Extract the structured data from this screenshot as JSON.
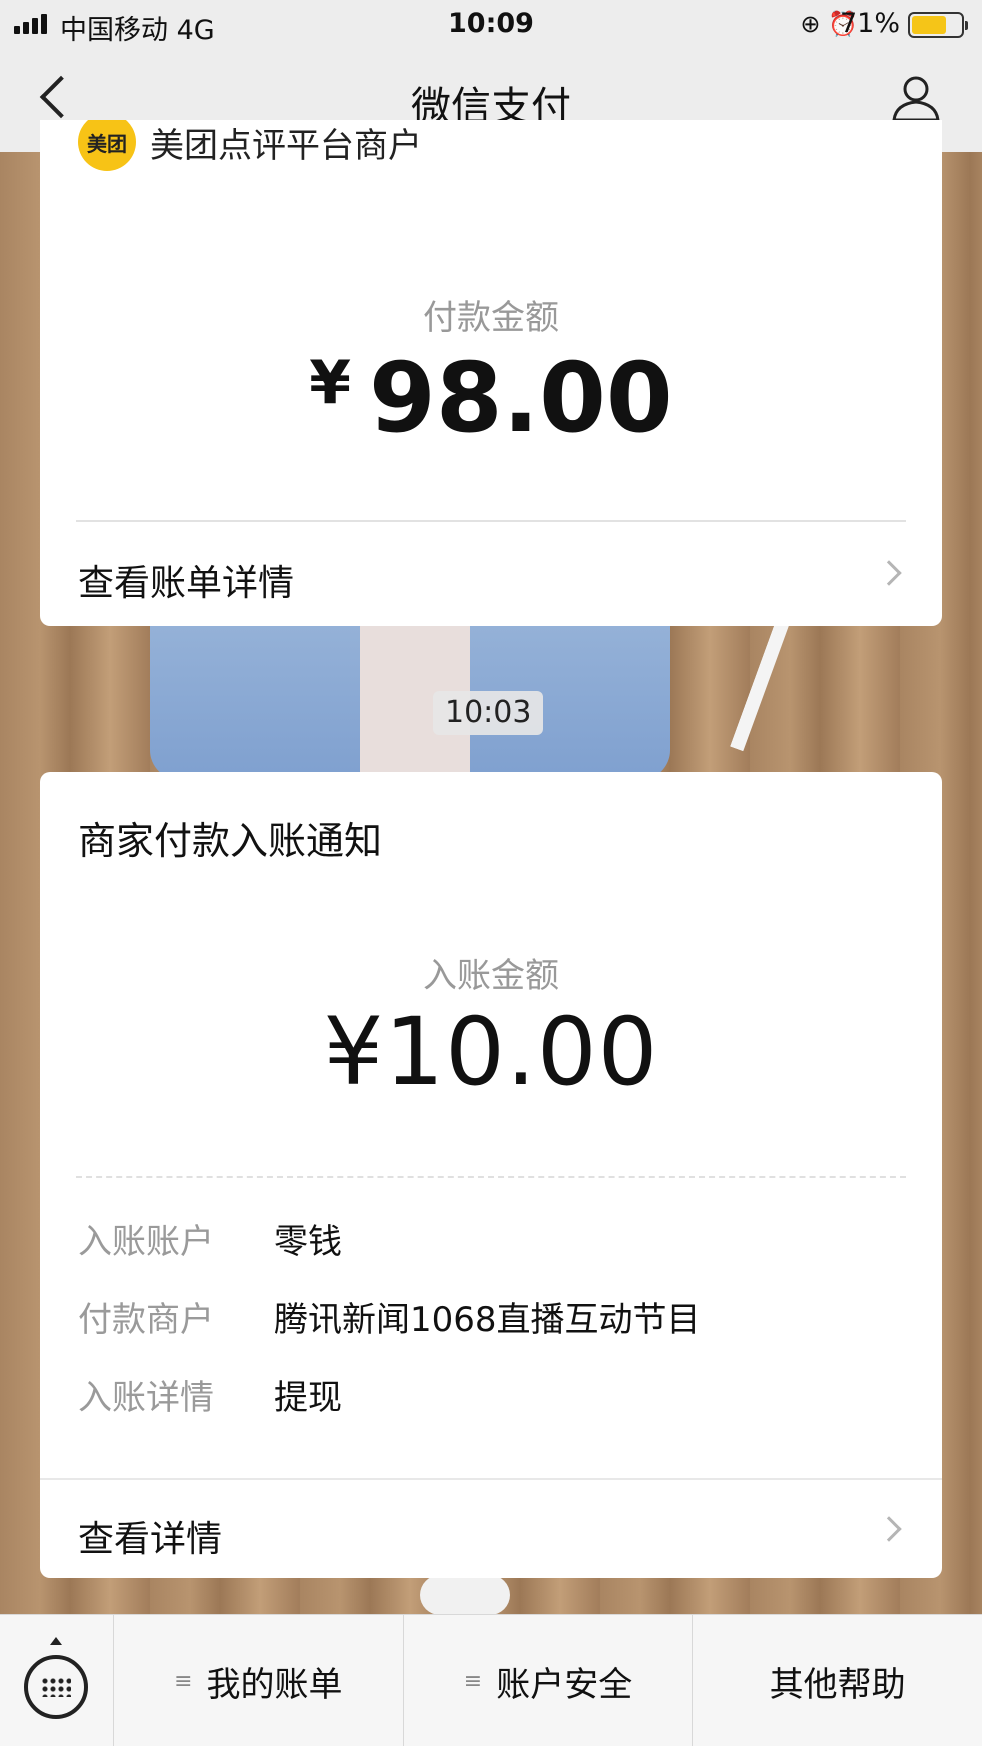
{
  "status_bar": {
    "carrier": "中国移动  4G",
    "time": "10:09",
    "icons": [
      "rotation-lock-icon",
      "alarm-icon"
    ],
    "battery_pct": "71%",
    "battery_level": 0.71
  },
  "nav": {
    "title": "微信支付",
    "back_icon": "back-chevron-icon",
    "user_icon": "user-icon"
  },
  "payment_card": {
    "merchant_logo_text": "美团",
    "merchant_name": "美团点评平台商户",
    "amount_label": "付款金额",
    "currency": "¥",
    "amount": "98.00",
    "detail_link": "查看账单详情"
  },
  "timestamp": "10:03",
  "notice_card": {
    "title": "商家付款入账通知",
    "amount_label": "入账金额",
    "amount": "¥10.00",
    "rows": [
      {
        "key": "入账账户",
        "value": "零钱"
      },
      {
        "key": "付款商户",
        "value": "腾讯新闻1068直播互动节目"
      },
      {
        "key": "入账详情",
        "value": "提现"
      }
    ],
    "detail_link": "查看详情"
  },
  "bottom_bar": {
    "keyboard_icon": "keyboard-icon",
    "menu_glyph": "≡",
    "items": [
      "我的账单",
      "账户安全",
      "其他帮助"
    ]
  },
  "colors": {
    "brand_yellow": "#f7c316",
    "bar_bg": "#ededed",
    "label_gray": "#9a9a9a"
  }
}
